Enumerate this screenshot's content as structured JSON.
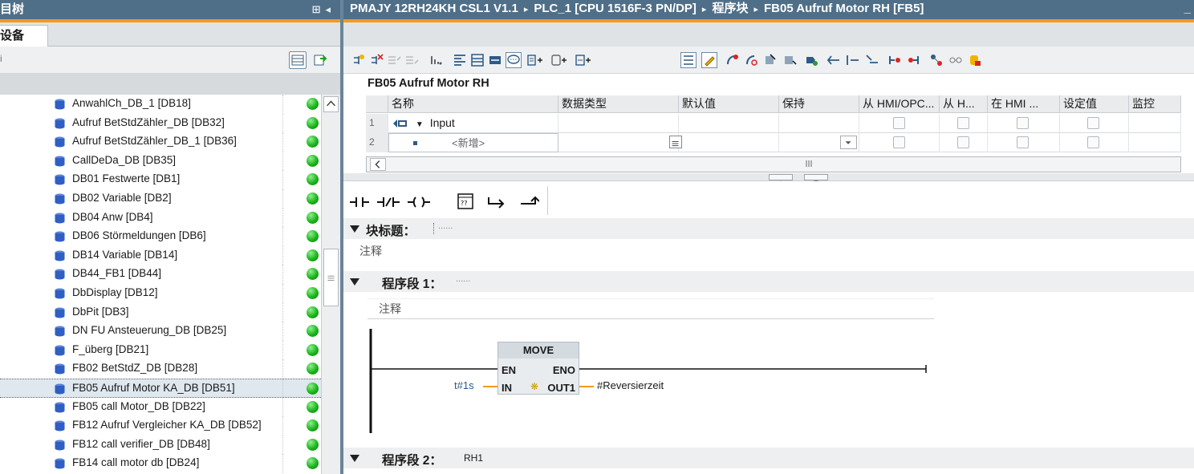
{
  "left_panel": {
    "title": "目树",
    "tab": "设备",
    "toolbar_left": "i",
    "tree": [
      "AnwahlCh_DB_1 [DB18]",
      "Aufruf BetStdZähler_DB [DB32]",
      "Aufruf BetStdZähler_DB_1 [DB36]",
      "CallDeDa_DB [DB35]",
      "DB01 Festwerte [DB1]",
      "DB02 Variable [DB2]",
      "DB04 Anw [DB4]",
      "DB06 Störmeldungen [DB6]",
      "DB14 Variable [DB14]",
      "DB44_FB1 [DB44]",
      "DbDisplay [DB12]",
      "DbPit [DB3]",
      "DN FU Ansteuerung_DB [DB25]",
      "F_überg [DB21]",
      "FB02 BetStdZ_DB [DB28]",
      "FB05 Aufruf Motor KA_DB [DB51]",
      "FB05 call Motor_DB [DB22]",
      "FB12 Aufruf Vergleicher KA_DB [DB52]",
      "FB12 call verifier_DB [DB48]",
      "FB14 call motor db [DB24]"
    ],
    "selected_index": 15,
    "status_color": "#1bb51b"
  },
  "breadcrumb": {
    "items": [
      "PMAJY 12RH24KH CSL1 V1.1",
      "PLC_1 [CPU 1516F-3 PN/DP]",
      "程序块",
      "FB05 Aufruf Motor RH [FB5]"
    ],
    "separator": "▸",
    "minimize": "_"
  },
  "interface": {
    "title": "FB05 Aufruf Motor RH",
    "columns": [
      "名称",
      "数据类型",
      "默认值",
      "保持",
      "从 HMI/OPC...",
      "从 H...",
      "在 HMI ...",
      "设定值",
      "监控"
    ],
    "rows": [
      {
        "num": "1",
        "name": "Input",
        "type": "",
        "placeholder": ""
      },
      {
        "num": "2",
        "name": "",
        "type": "",
        "placeholder": "<新增>"
      }
    ]
  },
  "editor": {
    "block_title_label": "块标题：",
    "block_title_value": "......",
    "block_comment": "注释",
    "network1_title": "程序段 1：",
    "network1_title_value": "......",
    "network1_comment": "注释",
    "network2_title": "程序段 2：",
    "network2_name": "RH1",
    "move_box": {
      "name": "MOVE",
      "en": "EN",
      "eno": "ENO",
      "in": "IN",
      "out": "OUT1",
      "in_value": "t#1s",
      "out_value": "#Reversierzeit"
    }
  },
  "colors": {
    "titlebar": "#4f6f89",
    "accent_orange": "#f39a1e",
    "status_green": "#1bb51b"
  }
}
